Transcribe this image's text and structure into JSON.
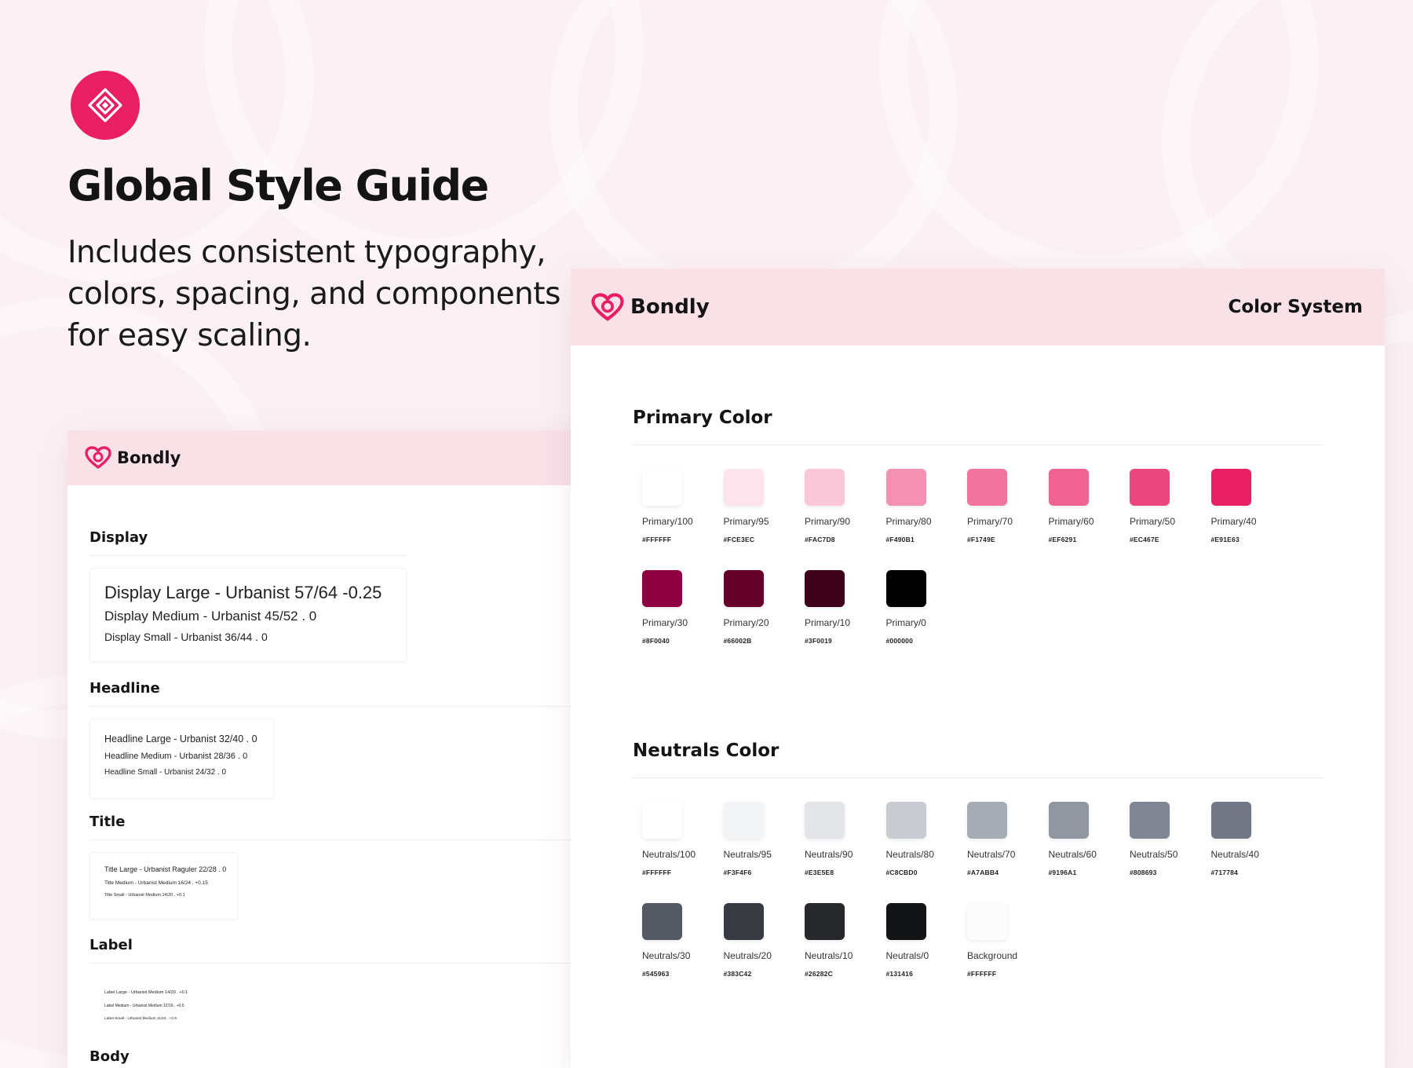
{
  "hero": {
    "title": "Global Style Guide",
    "subtitle": "Includes consistent typography, colors, spacing, and components for easy scaling."
  },
  "brand": {
    "name": "Bondly",
    "accent": "#E91E63",
    "header_bg": "#F9E1E8"
  },
  "icons": [
    "diamond-logo-icon",
    "heart-logo-icon"
  ],
  "typography_card": {
    "sections": [
      {
        "title": "Display",
        "lines": [
          "Display Large - Urbanist 57/64 -0.25",
          "Display Medium - Urbanist 45/52 .  0",
          "Display Small - Urbanist 36/44 . 0"
        ]
      },
      {
        "title": "Headline",
        "lines": [
          "Headline Large - Urbanist 32/40 . 0",
          "Headline Medium - Urbanist 28/36 . 0",
          "Headline Small - Urbanist 24/32 . 0"
        ]
      },
      {
        "title": "Title",
        "lines": [
          "Title Large - Urbanist Raguler 22/28 . 0",
          "Title Medium - Urbanist Medium 16/24 . +0.15",
          "Title Small - Urbanist Medium 14/20 . +0.1"
        ]
      },
      {
        "title": "Label",
        "lines": [
          "Label Large - Urbanist Medium 14/20 . +0.1",
          "Label Medium - Urbanist Medium 12/16 . +0.5",
          "Label Small - Urbanist Medium 11/16 . +0.5"
        ]
      },
      {
        "title": "Body",
        "lines": []
      }
    ]
  },
  "color_card": {
    "header_title": "Color System",
    "palettes": [
      {
        "title": "Primary Color",
        "rows": [
          [
            {
              "name": "Primary/100",
              "hex": "#FFFFFF",
              "color": "#FFFFFF"
            },
            {
              "name": "Primary/95",
              "hex": "#FCE3EC",
              "color": "#FCE3EC"
            },
            {
              "name": "Primary/90",
              "hex": "#FAC7D8",
              "color": "#FAC7D8"
            },
            {
              "name": "Primary/80",
              "hex": "#F490B1",
              "color": "#F490B1"
            },
            {
              "name": "Primary/70",
              "hex": "#F1749E",
              "color": "#F1749E"
            },
            {
              "name": "Primary/60",
              "hex": "#EF6291",
              "color": "#EF6291"
            },
            {
              "name": "Primary/50",
              "hex": "#EC467E",
              "color": "#EC467E"
            },
            {
              "name": "Primary/40",
              "hex": "#E91E63",
              "color": "#E91E63"
            }
          ],
          [
            {
              "name": "Primary/30",
              "hex": "#8F0040",
              "color": "#8F0040"
            },
            {
              "name": "Primary/20",
              "hex": "#66002B",
              "color": "#66002B"
            },
            {
              "name": "Primary/10",
              "hex": "#3F0019",
              "color": "#3F0019"
            },
            {
              "name": "Primary/0",
              "hex": "#000000",
              "color": "#000000"
            }
          ]
        ]
      },
      {
        "title": "Neutrals Color",
        "rows": [
          [
            {
              "name": "Neutrals/100",
              "hex": "#FFFFFF",
              "color": "#FFFFFF"
            },
            {
              "name": "Neutrals/95",
              "hex": "#F3F4F6",
              "color": "#F3F4F6"
            },
            {
              "name": "Neutrals/90",
              "hex": "#E3E5E8",
              "color": "#E3E5E8"
            },
            {
              "name": "Neutrals/80",
              "hex": "#C8CBD0",
              "color": "#C8CBD0"
            },
            {
              "name": "Neutrals/70",
              "hex": "#A7ABB4",
              "color": "#A7ABB4"
            },
            {
              "name": "Neutrals/60",
              "hex": "#9196A1",
              "color": "#9196A1"
            },
            {
              "name": "Neutrals/50",
              "hex": "#808693",
              "color": "#808693"
            },
            {
              "name": "Neutrals/40",
              "hex": "#717784",
              "color": "#717784"
            }
          ],
          [
            {
              "name": "Neutrals/30",
              "hex": "#545963",
              "color": "#545963"
            },
            {
              "name": "Neutrals/20",
              "hex": "#383C42",
              "color": "#383C42"
            },
            {
              "name": "Neutrals/10",
              "hex": "#26282C",
              "color": "#26282C"
            },
            {
              "name": "Neutrals/0",
              "hex": "#131416",
              "color": "#131416"
            },
            {
              "name": "Background",
              "hex": "#FFFFFF",
              "color": "#FCFCFC"
            }
          ]
        ]
      }
    ]
  }
}
